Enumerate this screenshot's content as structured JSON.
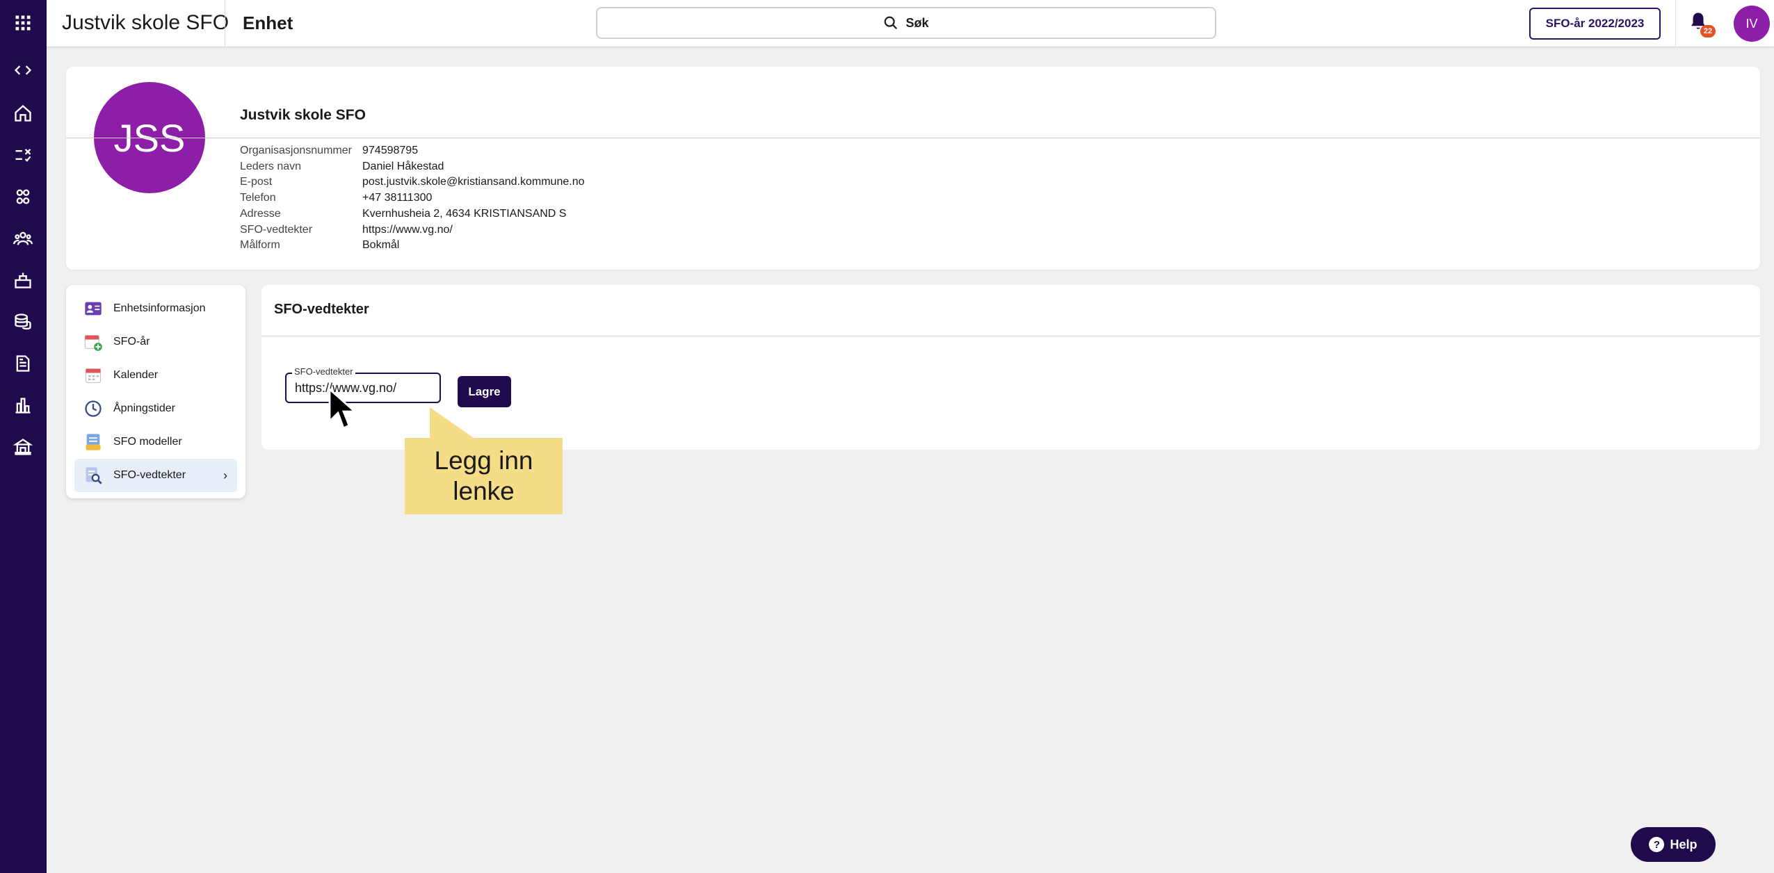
{
  "app": {
    "title": "Justvik skole SFO",
    "page_title": "Enhet"
  },
  "search": {
    "label": "Søk"
  },
  "topbar": {
    "year_button": "SFO-år 2022/2023",
    "notifications_count": "22",
    "user_initials": "IV"
  },
  "unit": {
    "initials": "JSS",
    "name": "Justvik skole SFO",
    "info": [
      {
        "key": "Organisasjonsnummer",
        "value": "974598795"
      },
      {
        "key": "Leders navn",
        "value": "Daniel Håkestad"
      },
      {
        "key": "E-post",
        "value": "post.justvik.skole@kristiansand.kommune.no"
      },
      {
        "key": "Telefon",
        "value": "+47 38111300"
      },
      {
        "key": "Adresse",
        "value": "Kvernhusheia 2, 4634 KRISTIANSAND S"
      },
      {
        "key": "SFO-vedtekter",
        "value": "https://www.vg.no/"
      },
      {
        "key": "Målform",
        "value": "Bokmål"
      }
    ]
  },
  "menu": {
    "items": [
      {
        "label": "Enhetsinformasjon",
        "icon": "id-card-icon"
      },
      {
        "label": "SFO-år",
        "icon": "calendar-add-icon"
      },
      {
        "label": "Kalender",
        "icon": "calendar-icon"
      },
      {
        "label": "Åpningstider",
        "icon": "clock-icon"
      },
      {
        "label": "SFO modeller",
        "icon": "document-stack-icon"
      },
      {
        "label": "SFO-vedtekter",
        "icon": "document-search-icon",
        "active": true
      }
    ]
  },
  "content": {
    "title": "SFO-vedtekter",
    "field_label": "SFO-vedtekter",
    "field_value": "https://www.vg.no/",
    "save_label": "Lagre"
  },
  "callout": {
    "line1": "Legg inn",
    "line2": "lenke"
  },
  "help": {
    "label": "Help"
  },
  "colors": {
    "primary": "#1f0a4d",
    "avatar": "#8c1ea8",
    "callout": "#f5dc86",
    "badge": "#e45424"
  }
}
